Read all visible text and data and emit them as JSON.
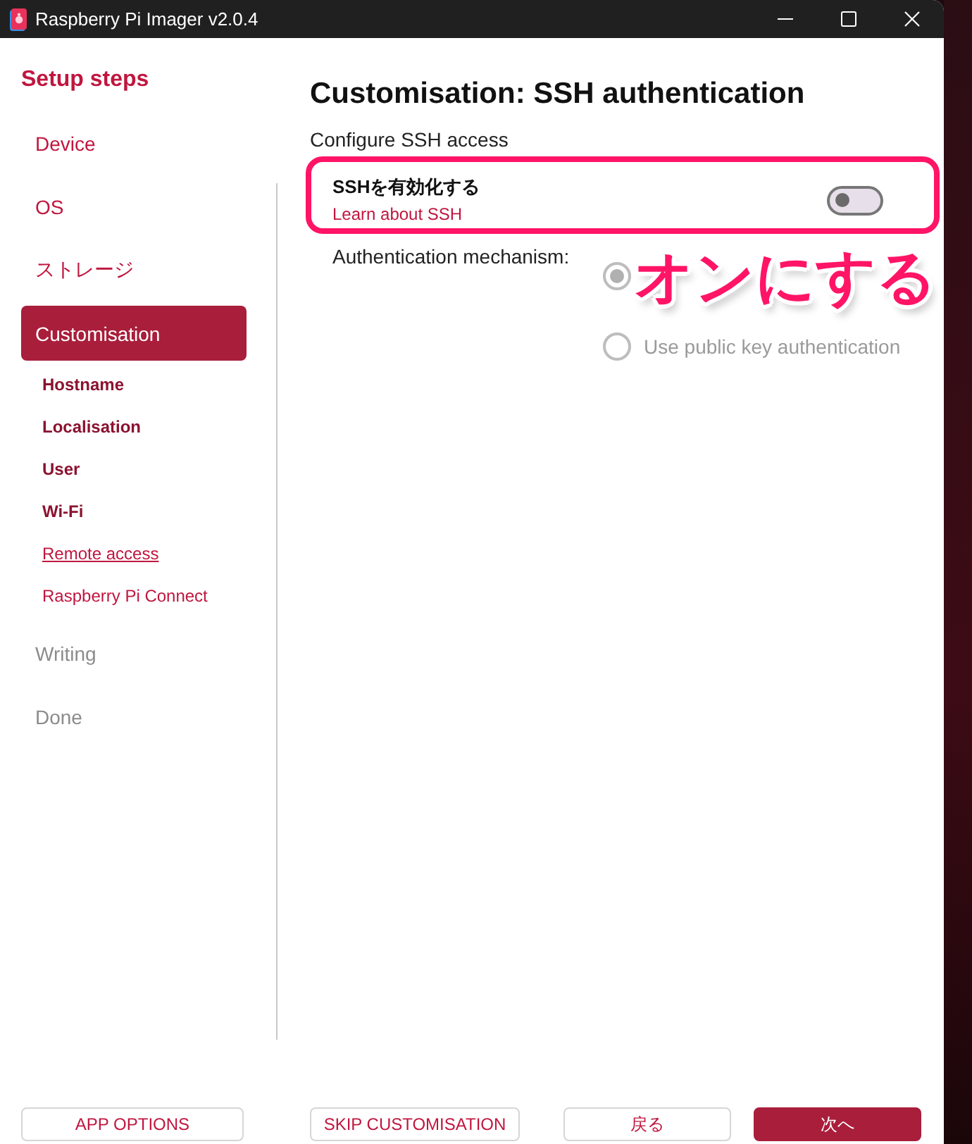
{
  "window": {
    "title": "Raspberry Pi Imager v2.0.4"
  },
  "sidebar": {
    "heading": "Setup steps",
    "steps": [
      {
        "label": "Device",
        "selected": false,
        "disabled": false
      },
      {
        "label": "OS",
        "selected": false,
        "disabled": false
      },
      {
        "label": "ストレージ",
        "selected": false,
        "disabled": false
      },
      {
        "label": "Customisation",
        "selected": true,
        "disabled": false,
        "children": [
          {
            "label": "Hostname",
            "selected": false,
            "completed": true
          },
          {
            "label": "Localisation",
            "selected": false,
            "completed": true
          },
          {
            "label": "User",
            "selected": false,
            "completed": true
          },
          {
            "label": "Wi-Fi",
            "selected": false,
            "completed": true
          },
          {
            "label": "Remote access",
            "selected": true,
            "completed": false
          },
          {
            "label": "Raspberry Pi Connect",
            "selected": false,
            "completed": false
          }
        ]
      },
      {
        "label": "Writing",
        "selected": false,
        "disabled": true
      },
      {
        "label": "Done",
        "selected": false,
        "disabled": true
      }
    ]
  },
  "page": {
    "title": "Customisation: SSH authentication",
    "subtitle": "Configure SSH access",
    "ssh_toggle": {
      "label": "SSHを有効化する",
      "link": "Learn about SSH",
      "on": false
    },
    "auth": {
      "label": "Authentication mechanism:",
      "options": [
        {
          "selected": true,
          "disabled": true
        },
        {
          "label": "Use public key authentication",
          "selected": false,
          "disabled": true
        }
      ]
    }
  },
  "annotation": {
    "text": "オンにする"
  },
  "buttons": [
    {
      "label": "APP OPTIONS",
      "kind": "outline"
    },
    {
      "label": "SKIP CUSTOMISATION",
      "kind": "outline"
    },
    {
      "label": "戻る",
      "kind": "outline"
    },
    {
      "label": "次へ",
      "kind": "primary"
    }
  ]
}
